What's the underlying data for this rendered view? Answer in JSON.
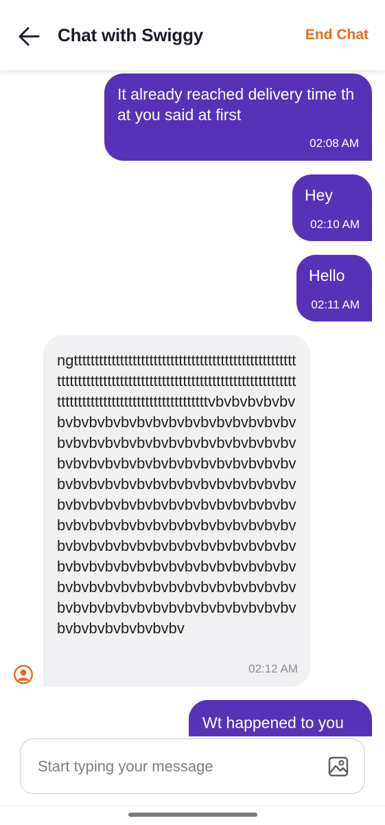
{
  "header": {
    "title": "Chat with Swiggy",
    "end_chat_label": "End Chat",
    "back_icon": "arrow-left-icon"
  },
  "messages": [
    {
      "direction": "outgoing",
      "text": "It already reached delivery time that you said at first",
      "time": "02:08 AM"
    },
    {
      "direction": "outgoing",
      "text": "Hey",
      "time": "02:10 AM"
    },
    {
      "direction": "outgoing",
      "text": "Hello",
      "time": "02:11 AM"
    },
    {
      "direction": "incoming",
      "text": "ngttttttttttttttttttttttttttttttttttttttttttttttttttttttttttttttttttttttttttttttttttttttttttttttttttttttttttttttttttttttttttttttttttttttttttttttttttvbvbvbvbvbvbvbvbvbvbvbvbvbvbvbvbvbvbvbvbvbvbvbvbvbvbvbvbvbvbvbvbvbvbvbvbvbvbvbvbvbvbvbvbvbvbvbvbvbvbvbvbvbvbvbvbvbvbvbvbvbvbvbvbvbvbvbvbvbvbvbvbvbvbvbvbvbvbvbvbvbvbvbvbvbvbvbvbvbvbvbvbvbvbvbvbvbvbvbvbvbvbvbvbvbvbvbvbvbvbvbvbvbvbvbvbvbvbvbvbvbvbvbvbvbvbvbvbvbvbvbvbvbvbvbvbvbvbvbvbvbvbvbvbvbvbvbvbvbvbvbvbvbvbvbvbvbvbvbvbvbvbvbv",
      "time": "02:12 AM"
    },
    {
      "direction": "outgoing",
      "text": "Wt happened to you",
      "time": ""
    }
  ],
  "input": {
    "placeholder": "Start typing your message",
    "value": "",
    "attach_icon": "image-icon"
  },
  "colors": {
    "accent": "#e8691d",
    "outgoing_bubble": "#5732b8",
    "incoming_bubble": "#f1f1f4"
  }
}
